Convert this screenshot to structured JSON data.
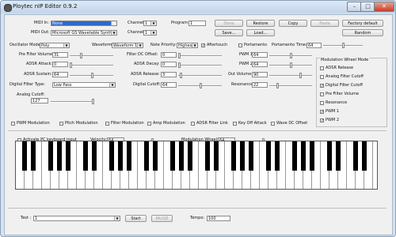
{
  "window": {
    "title": "Ploytec nIP Editor 0.9.2"
  },
  "midi_in": {
    "label": "MIDI In:",
    "value": "None"
  },
  "midi_out": {
    "label": "MIDI Out:",
    "value": "Microsoft GS Wavetable Synth"
  },
  "channel_in": {
    "label": "Channel:",
    "value": "1"
  },
  "channel_out": {
    "label": "Channel:",
    "value": "1"
  },
  "program": {
    "label": "Program:",
    "value": "1"
  },
  "buttons": {
    "store": "Store",
    "restore": "Restore",
    "copy": "Copy",
    "paste": "Paste",
    "factory_default": "Factory default",
    "save": "Save...",
    "load": "Load...",
    "random": "Random",
    "start": "Start",
    "pause": "PAUSE"
  },
  "oscillator_mode": {
    "label": "Oscillator Mode:",
    "value": "Poly"
  },
  "waveform": {
    "label": "Waveform:",
    "value": "Waveform 1"
  },
  "note_priority": {
    "label": "Note Priority:",
    "value": "Highest"
  },
  "aftertouch": {
    "label": "Aftertouch",
    "checked": true
  },
  "portamento": {
    "label": "Portamento",
    "checked": false
  },
  "portamento_time": {
    "label": "Portamento Time:",
    "value": "64"
  },
  "params": {
    "pre_filter_volume": {
      "label": "Pre Filter Volume:",
      "value": "31"
    },
    "filter_dc_offset": {
      "label": "Filter DC Offset:",
      "value": "0"
    },
    "pwm1": {
      "label": "PWM 1:",
      "value": "64"
    },
    "adsr_attack": {
      "label": "ADSR Attack:",
      "value": "0"
    },
    "adsr_decay": {
      "label": "ADSR Decay:",
      "value": "0"
    },
    "pwm2": {
      "label": "PWM 2:",
      "value": "64"
    },
    "adsr_sustain": {
      "label": "ADSR Sustain:",
      "value": "64"
    },
    "adsr_release": {
      "label": "ADSR Release:",
      "value": "3"
    },
    "out_volume": {
      "label": "Out Volume:",
      "value": "90"
    },
    "digital_cutoff": {
      "label": "Digital Cutoff:",
      "value": "64"
    },
    "resonance": {
      "label": "Resonance:",
      "value": "22"
    },
    "analog_cutoff": {
      "label": "Analog Cutoff:",
      "value": "127"
    }
  },
  "digital_filter_type": {
    "label": "Digital Filter Type:",
    "value": "Low Pass"
  },
  "mod_wheel": {
    "title": "Modulation Wheel Mode",
    "items": [
      {
        "label": "ADSR Release",
        "checked": false
      },
      {
        "label": "Analog Filter Cutoff",
        "checked": false
      },
      {
        "label": "Digital Filter Cutoff",
        "checked": true
      },
      {
        "label": "Pre Filter Volume",
        "checked": false
      },
      {
        "label": "Resonance",
        "checked": false
      },
      {
        "label": "PWM 1",
        "checked": true
      },
      {
        "label": "PWM 2",
        "checked": true
      }
    ]
  },
  "modulations": [
    {
      "label": "PWM Modulation",
      "checked": false
    },
    {
      "label": "Pitch Modulation",
      "checked": false
    },
    {
      "label": "Filter Modulation",
      "checked": false
    },
    {
      "label": "Amp Modulation",
      "checked": false
    },
    {
      "label": "ADSR Filter Link",
      "checked": false
    },
    {
      "label": "Key Off Attack",
      "checked": false
    },
    {
      "label": "Wave DC Offset",
      "checked": false
    }
  ],
  "pc_keyboard": {
    "label": "Activate PC keyboard input",
    "checked": false
  },
  "velocity": {
    "label": "Velocity:",
    "value": "64"
  },
  "mod_wheel_value": {
    "label": "Modulation Wheel:",
    "value": "64"
  },
  "test": {
    "label": "Test :",
    "value": "1"
  },
  "tempo": {
    "label": "Tempo:",
    "value": "100"
  }
}
